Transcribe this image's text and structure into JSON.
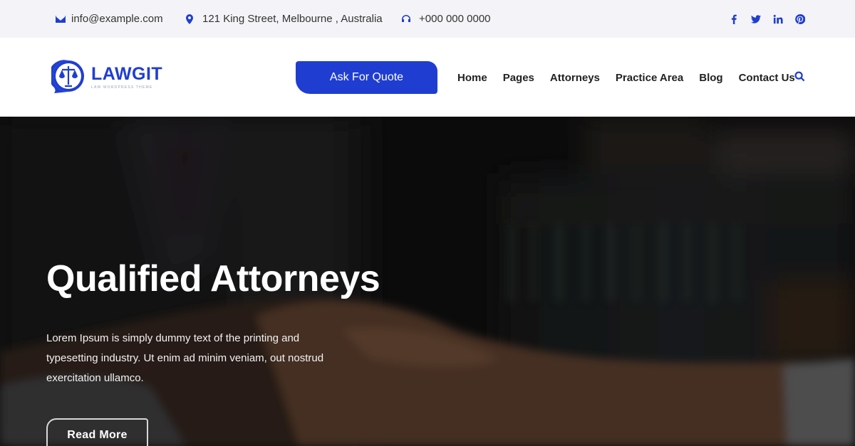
{
  "topbar": {
    "email": "info@example.com",
    "address": "121 King Street, Melbourne , Australia",
    "phone": "+000 000 0000",
    "social": [
      "facebook-icon",
      "twitter-icon",
      "linkedin-icon",
      "pinterest-icon"
    ]
  },
  "header": {
    "logo_title": "LAWGIT",
    "logo_tagline": "LAW WORDPRESS THEME",
    "quote_label": "Ask For Quote",
    "nav": [
      "Home",
      "Pages",
      "Attorneys",
      "Practice Area",
      "Blog",
      "Contact Us"
    ]
  },
  "hero": {
    "title": "Qualified Attorneys",
    "text": "Lorem Ipsum is simply dummy text of the printing and typesetting industry. Ut enim ad minim veniam, out nostrud exercitation ullamco.",
    "button_label": "Read More"
  },
  "colors": {
    "accent": "#1f3ed1",
    "topbar_bg": "#f4f4f8",
    "hero_overlay": "#161616"
  }
}
